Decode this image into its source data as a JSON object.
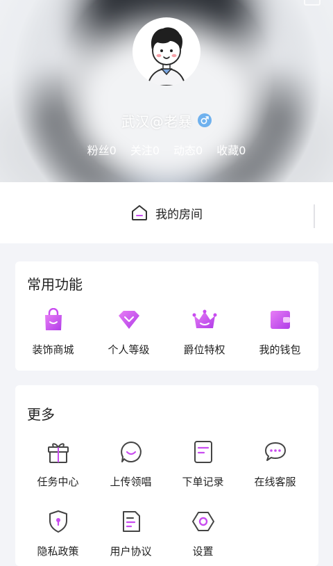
{
  "profile": {
    "username": "武汉@老暴",
    "gender_icon": "male-icon",
    "stats": [
      "粉丝0",
      "关注0",
      "动态0",
      "收藏0"
    ]
  },
  "room": {
    "label": "我的房间",
    "icon": "home-icon"
  },
  "common": {
    "title": "常用功能",
    "items": [
      {
        "label": "装饰商城",
        "icon": "shopping-bag-icon"
      },
      {
        "label": "个人等级",
        "icon": "diamond-icon"
      },
      {
        "label": "爵位特权",
        "icon": "crown-icon"
      },
      {
        "label": "我的钱包",
        "icon": "wallet-icon"
      }
    ],
    "accent": "#c94cf0"
  },
  "more": {
    "title": "更多",
    "items": [
      {
        "label": "任务中心",
        "icon": "gift-icon"
      },
      {
        "label": "上传领唱",
        "icon": "smile-chat-icon"
      },
      {
        "label": "下单记录",
        "icon": "document-icon"
      },
      {
        "label": "在线客服",
        "icon": "chat-bubble-icon"
      },
      {
        "label": "隐私政策",
        "icon": "shield-icon"
      },
      {
        "label": "用户协议",
        "icon": "agreement-icon"
      },
      {
        "label": "设置",
        "icon": "settings-icon"
      }
    ]
  }
}
